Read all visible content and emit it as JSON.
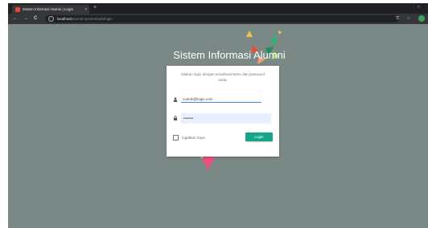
{
  "browser": {
    "tab_title": "Sistem Informasi Alumni | Login",
    "tab_close": "×",
    "new_tab": "+",
    "window_controls": "□",
    "address_host": "localhost",
    "address_path": "/alumni-system/auth/login",
    "back_icon": "←",
    "forward_icon": "→",
    "reload_icon": "C",
    "key_icon": "⚿",
    "star_icon": "☆"
  },
  "page": {
    "title": "Sistem Informasi Alumni",
    "message": "Silakan login dengan email/username dan password anda.",
    "email_value": "contoh@login.com",
    "password_value": "•••••••",
    "remember_label": "Ingatkan Saya",
    "login_label": "Login"
  },
  "colors": {
    "background": "#7b8986",
    "accent": "#17a589",
    "tab_favicon": "#e8423b",
    "input_focus": "#3f83f8"
  }
}
